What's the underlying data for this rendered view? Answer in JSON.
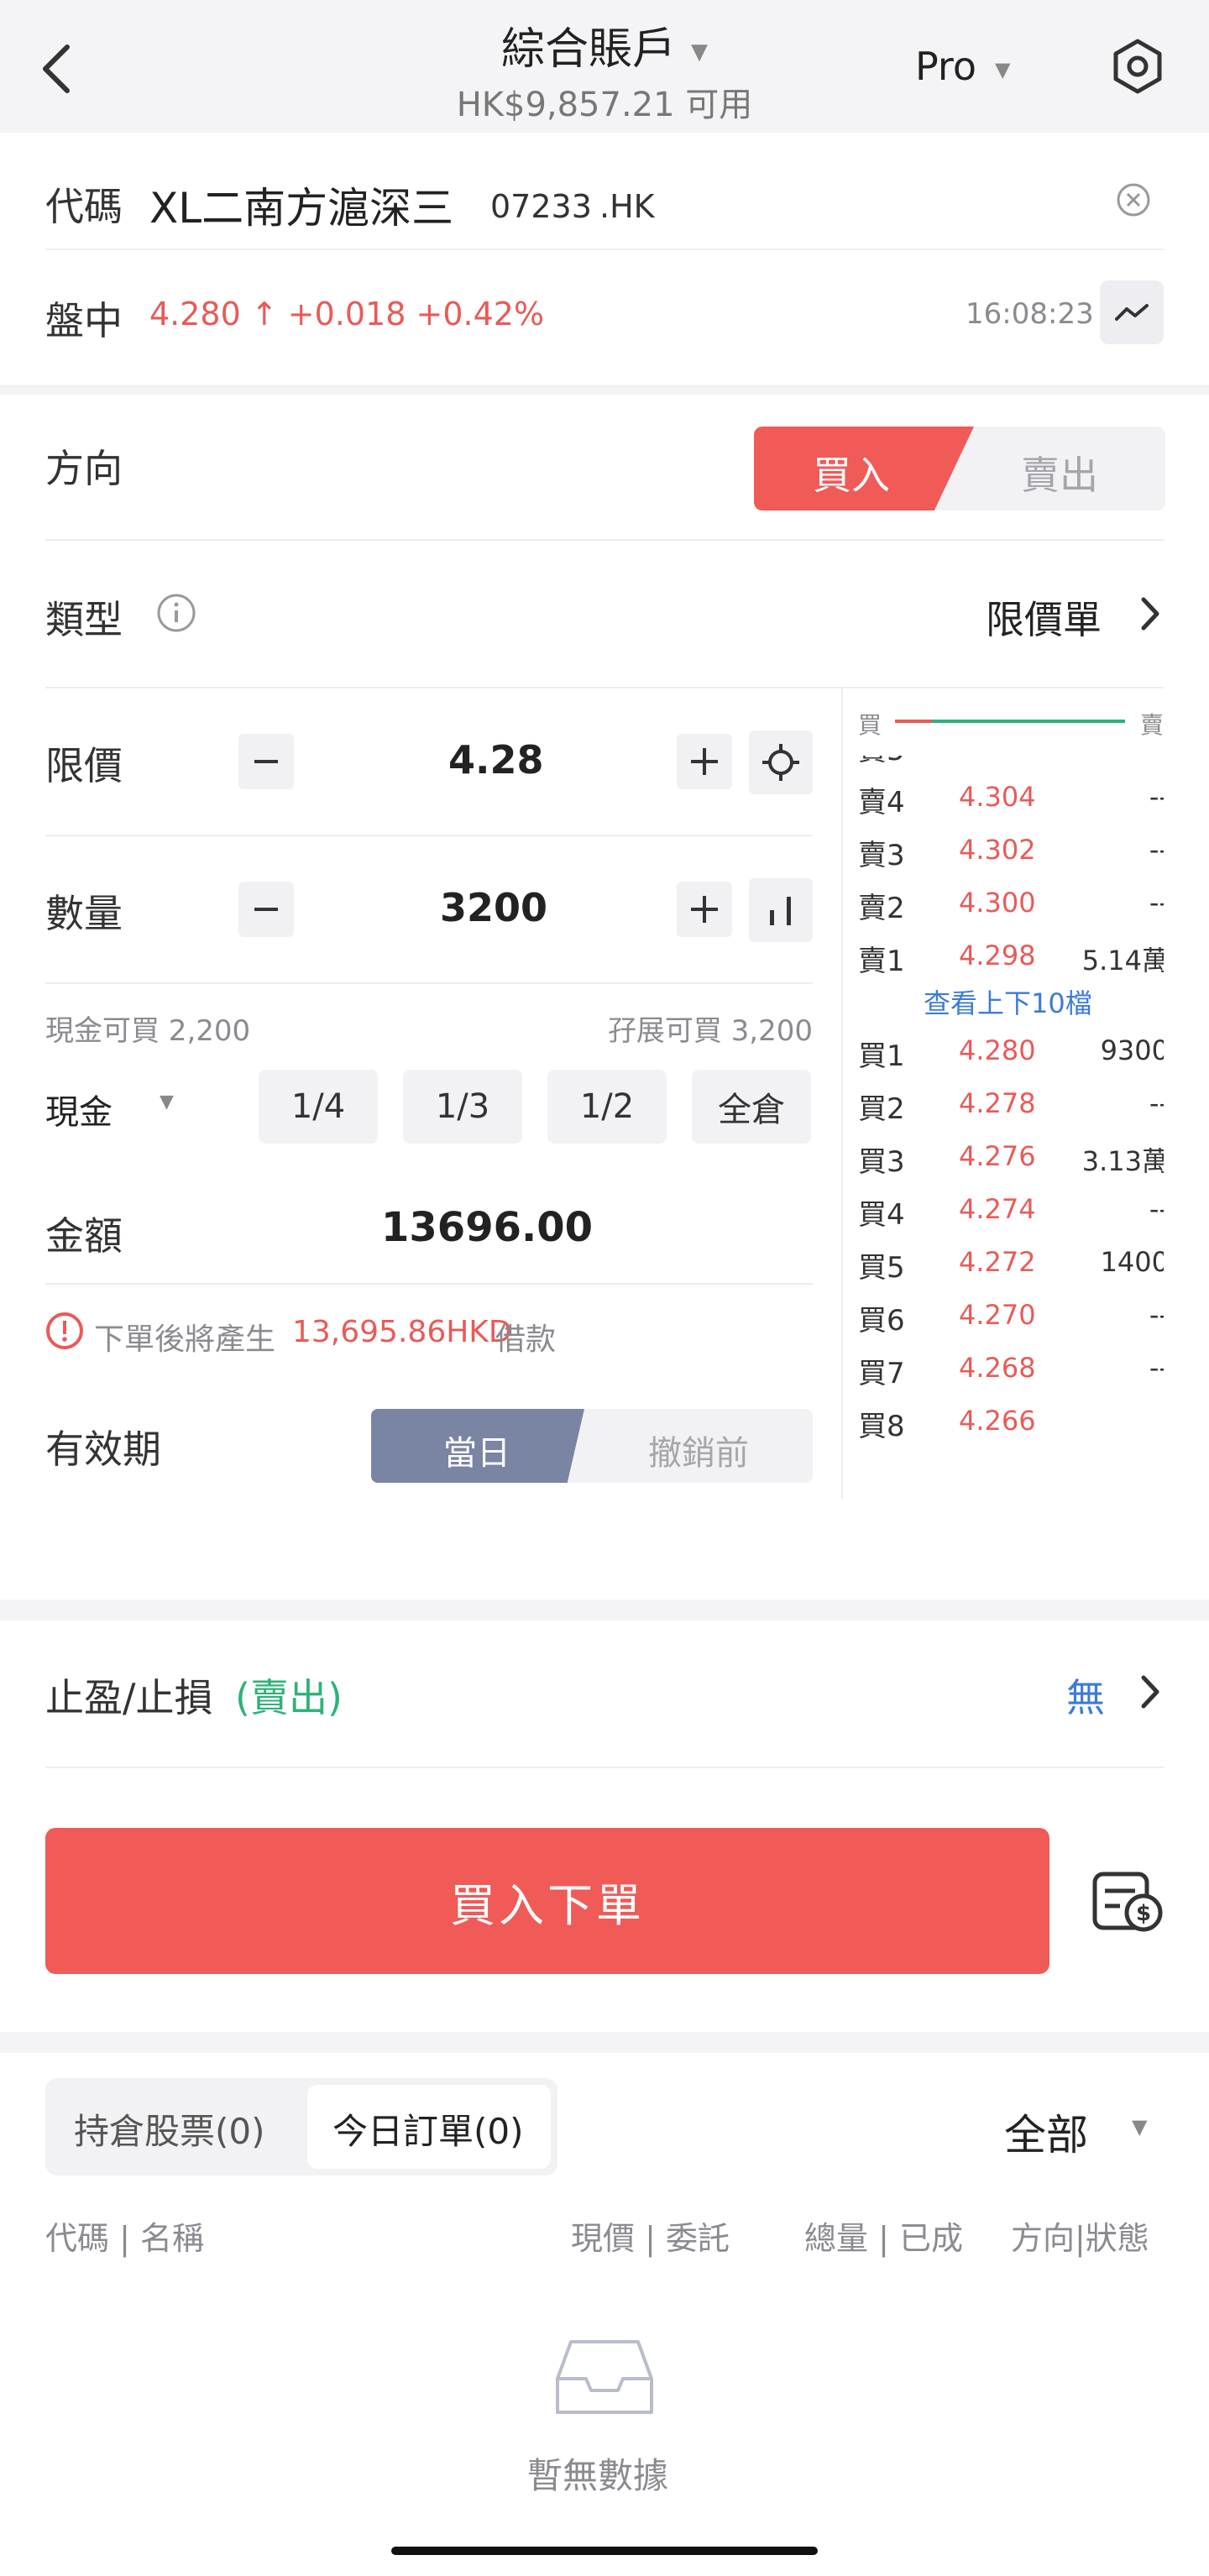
{
  "header": {
    "account_title": "綜合賬戶",
    "available_balance": "HK$9,857.21 可用",
    "mode": "Pro"
  },
  "security": {
    "code_label": "代碼",
    "name": "XL二南方滬深三",
    "code": "07233",
    "market": ".HK"
  },
  "quote": {
    "session": "盤中",
    "price": "4.280 ↑ +0.018 +0.42%",
    "time": "16:08:23"
  },
  "order": {
    "direction_label": "方向",
    "buy_label": "買入",
    "sell_label": "賣出",
    "type_label": "類型",
    "type_value": "限價單",
    "price_label": "限價",
    "price_value": "4.28",
    "qty_label": "數量",
    "qty_value": "3200",
    "cash_buyable": "現金可買 2,200",
    "margin_buyable": "孖展可買 3,200",
    "pay_method": "現金",
    "fractions": [
      "1/4",
      "1/3",
      "1/2",
      "全倉"
    ],
    "amount_label": "金額",
    "amount_value": "13696.00",
    "warning_prefix": "下單後將產生",
    "warning_amount": "13,695.86HKD",
    "warning_suffix": "借款",
    "validity_label": "有效期",
    "validity_day": "當日",
    "validity_gtc": "撤銷前"
  },
  "orderbook": {
    "buy_head": "買",
    "sell_head": "賣",
    "view_more": "查看上下10檔",
    "asks": [
      {
        "label": "賣4",
        "price": "4.304",
        "vol": "--"
      },
      {
        "label": "賣3",
        "price": "4.302",
        "vol": "--"
      },
      {
        "label": "賣2",
        "price": "4.300",
        "vol": "--"
      },
      {
        "label": "賣1",
        "price": "4.298",
        "vol": "5.14萬"
      }
    ],
    "bids": [
      {
        "label": "買1",
        "price": "4.280",
        "vol": "9300"
      },
      {
        "label": "買2",
        "price": "4.278",
        "vol": "--"
      },
      {
        "label": "買3",
        "price": "4.276",
        "vol": "3.13萬"
      },
      {
        "label": "買4",
        "price": "4.274",
        "vol": "--"
      },
      {
        "label": "買5",
        "price": "4.272",
        "vol": "1400"
      },
      {
        "label": "買6",
        "price": "4.270",
        "vol": "--"
      },
      {
        "label": "買7",
        "price": "4.268",
        "vol": "--"
      }
    ]
  },
  "tpsl": {
    "label": "止盈/止損",
    "side": "(賣出)",
    "value": "無"
  },
  "submit": {
    "label": "買入下單"
  },
  "positions": {
    "tab_holdings": "持倉股票(0)",
    "tab_orders": "今日訂單(0)",
    "filter": "全部",
    "col_code": "代碼 | 名稱",
    "col_price": "現價 | 委託",
    "col_qty": "總量 | 已成",
    "col_dir": "方向|狀態",
    "empty": "暫無數據"
  },
  "colors": {
    "accent_red": "#f05a57",
    "up_red": "#e95a57",
    "green": "#2db27a",
    "blue": "#3d7bd6",
    "validity_active": "#7a84a3"
  }
}
